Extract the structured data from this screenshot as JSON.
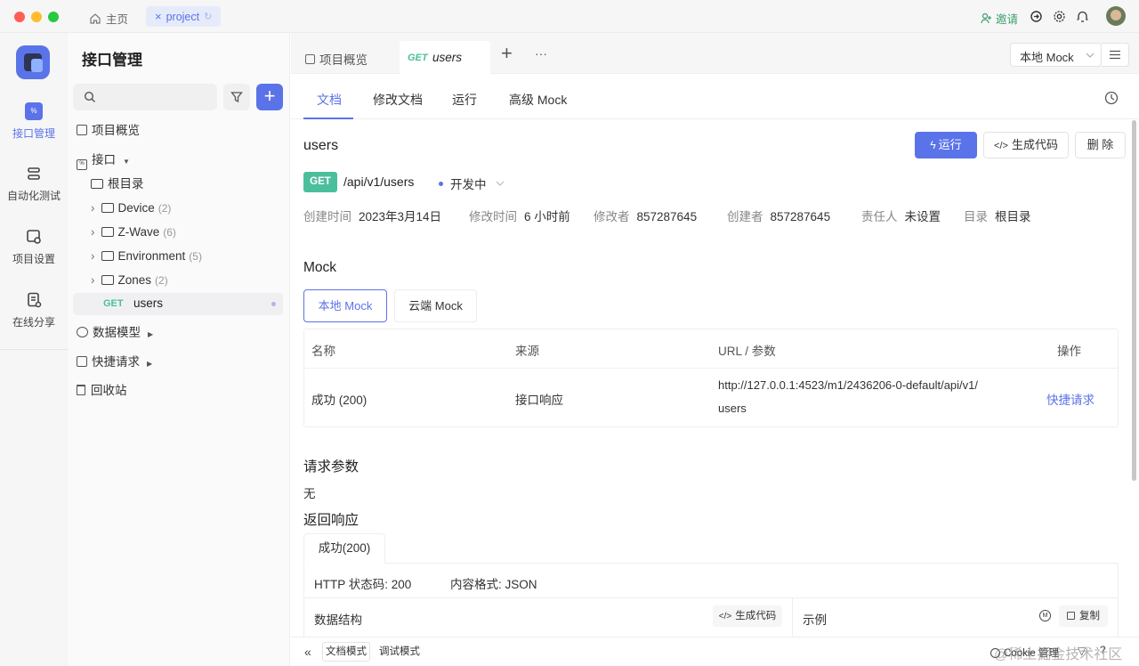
{
  "titlebar": {
    "home": "主页",
    "tab": "project",
    "invite": "邀请"
  },
  "rail": {
    "items": [
      {
        "label": "接口管理"
      },
      {
        "label": "自动化测试"
      },
      {
        "label": "项目设置"
      },
      {
        "label": "在线分享"
      }
    ]
  },
  "tree": {
    "title": "接口管理",
    "search_placeholder": "",
    "overview": "项目概览",
    "api": "接口",
    "root": "根目录",
    "folders": [
      {
        "name": "Device",
        "count": "(2)"
      },
      {
        "name": "Z-Wave",
        "count": "(6)"
      },
      {
        "name": "Environment",
        "count": "(5)"
      },
      {
        "name": "Zones",
        "count": "(2)"
      }
    ],
    "endpoint": {
      "method": "GET",
      "name": "users"
    },
    "models": "数据模型",
    "quick": "快捷请求",
    "trash": "回收站"
  },
  "tabs": {
    "overview": "项目概览",
    "active_method": "GET",
    "active_name": "users",
    "more": "···",
    "env": "本地 Mock"
  },
  "subtabs": [
    "文档",
    "修改文档",
    "运行",
    "高级 Mock"
  ],
  "doc": {
    "name": "users",
    "run": "运行",
    "gen": "生成代码",
    "del": "删 除",
    "method": "GET",
    "path": "/api/v1/users",
    "status": "开发中",
    "meta": [
      {
        "k": "创建时间",
        "v": "2023年3月14日"
      },
      {
        "k": "修改时间",
        "v": "6 小时前"
      },
      {
        "k": "修改者",
        "v": "857287645"
      },
      {
        "k": "创建者",
        "v": "857287645"
      },
      {
        "k": "责任人",
        "v": "未设置"
      },
      {
        "k": "目录",
        "v": "根目录"
      }
    ]
  },
  "mock": {
    "title": "Mock",
    "tab_local": "本地 Mock",
    "tab_cloud": "云端 Mock",
    "headers": [
      "名称",
      "来源",
      "URL / 参数",
      "操作"
    ],
    "row": {
      "name": "成功 (200)",
      "source": "接口响应",
      "url1": "http://127.0.0.1:4523/m1/2436206-0-default/api/v1/",
      "url2": "users",
      "action": "快捷请求"
    }
  },
  "params": {
    "title": "请求参数",
    "value": "无"
  },
  "response": {
    "title": "返回响应",
    "tab": "成功(200)",
    "code": "HTTP 状态码: 200",
    "format": "内容格式: JSON",
    "struct": "数据结构",
    "gen": "生成代码",
    "example": "示例",
    "copy": "复制"
  },
  "bottom": {
    "doc_mode": "文档模式",
    "debug_mode": "调试模式",
    "cookie": "Cookie 管理",
    "watermark": "@稀土掘金技术社区"
  },
  "colors": {
    "accent": "#5b73e8",
    "get": "#4bbf9b",
    "link": "#5b73e8"
  }
}
